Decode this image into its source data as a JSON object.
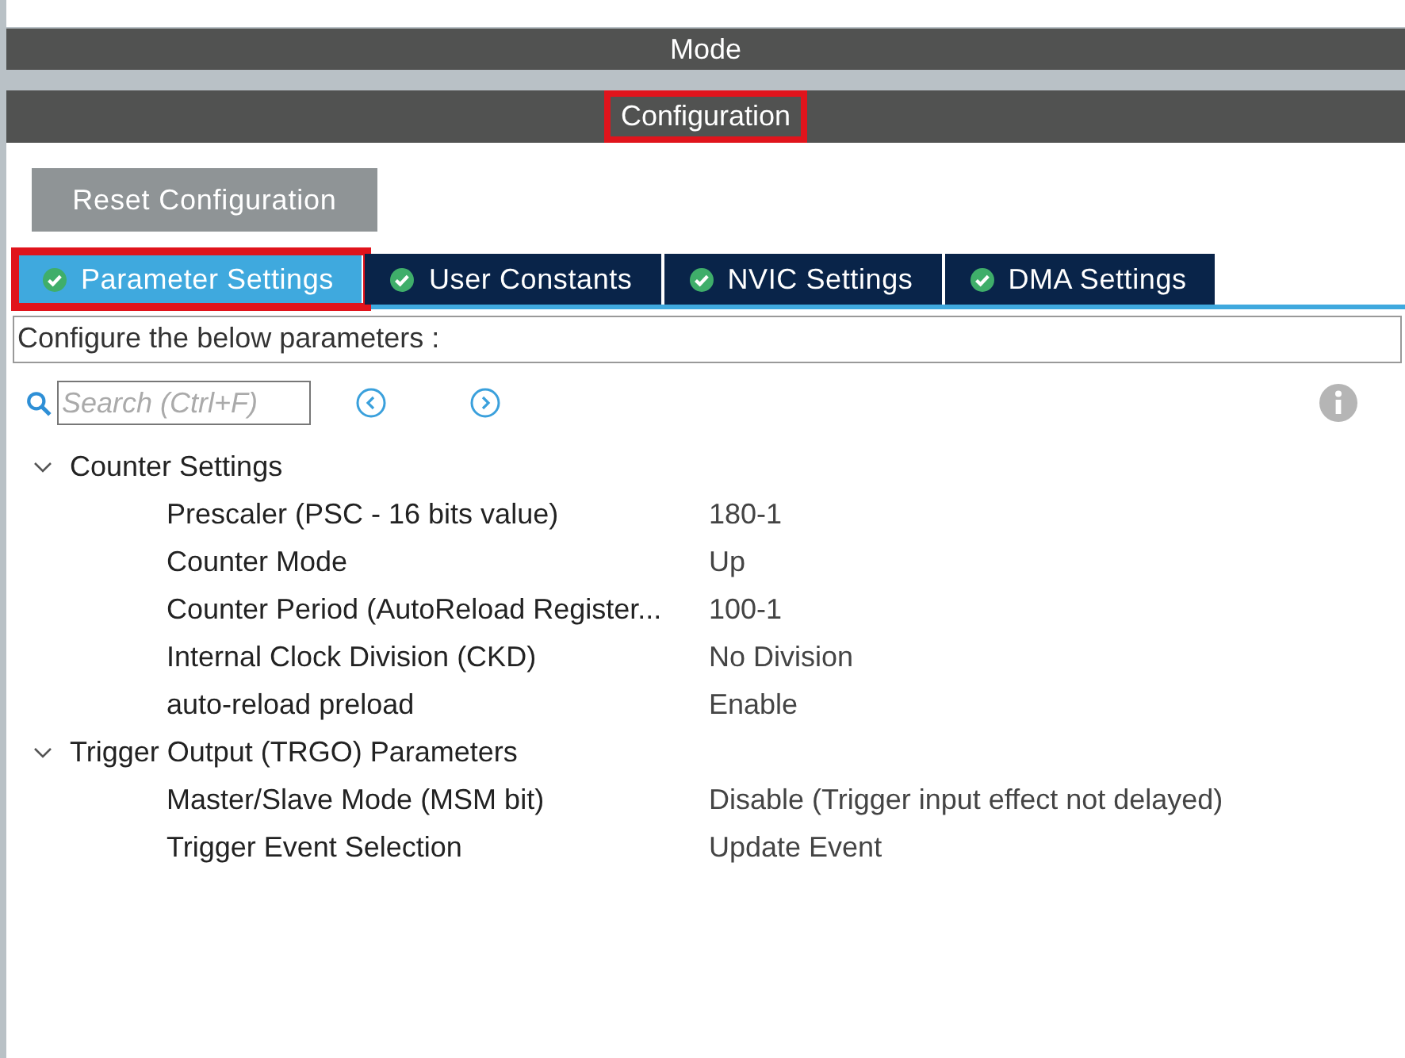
{
  "sections": [
    {
      "label": "Mode",
      "highlighted": false
    },
    {
      "label": "Configuration",
      "highlighted": true
    }
  ],
  "reset_button": "Reset Configuration",
  "tabs": [
    {
      "label": "Parameter Settings",
      "selected": true,
      "highlighted": true
    },
    {
      "label": "User Constants",
      "selected": false,
      "highlighted": false
    },
    {
      "label": "NVIC Settings",
      "selected": false,
      "highlighted": false
    },
    {
      "label": "DMA Settings",
      "selected": false,
      "highlighted": false
    }
  ],
  "description": "Configure the below parameters :",
  "search": {
    "placeholder": "Search (Ctrl+F)"
  },
  "groups": [
    {
      "label": "Counter Settings",
      "expanded": true,
      "children": [
        {
          "name": "Prescaler (PSC - 16 bits value)",
          "value": "180-1"
        },
        {
          "name": "Counter Mode",
          "value": "Up"
        },
        {
          "name": "Counter Period (AutoReload Register...",
          "value": "100-1"
        },
        {
          "name": "Internal Clock Division (CKD)",
          "value": "No Division"
        },
        {
          "name": "auto-reload preload",
          "value": "Enable"
        }
      ]
    },
    {
      "label": "Trigger Output (TRGO) Parameters",
      "expanded": true,
      "children": [
        {
          "name": "Master/Slave Mode (MSM bit)",
          "value": "Disable (Trigger input effect not delayed)"
        },
        {
          "name": "Trigger Event Selection",
          "value": "Update Event"
        }
      ]
    }
  ]
}
